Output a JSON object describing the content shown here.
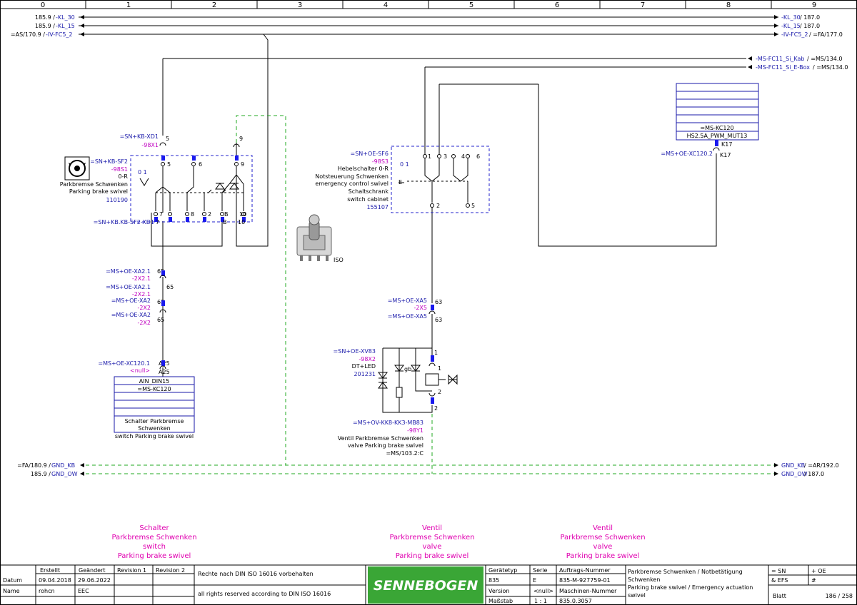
{
  "column_numbers": [
    "0",
    "1",
    "2",
    "3",
    "4",
    "5",
    "6",
    "7",
    "8",
    "9"
  ],
  "potentials": {
    "kl30": {
      "left_ref": "185.9 / ",
      "left_name": "-KL_30",
      "right_name": "-KL_30",
      "right_ref": " / 187.0"
    },
    "kl15": {
      "left_ref": "185.9 / ",
      "left_name": "-KL_15",
      "right_name": "-KL_15",
      "right_ref": " / 187.0"
    },
    "ivfc": {
      "left_ref": "=AS/170.9 / ",
      "left_name": "-IV-FC5_2",
      "right_name": "-IV-FC5_2",
      "right_ref": " / =FA/177.0"
    },
    "kab": {
      "name": "-MS-FC11_Si_Kab",
      "ref": " / =MS/134.0"
    },
    "ebox": {
      "name": "-MS-FC11_Si_E-Box",
      "ref": " / =MS/134.0"
    },
    "gndkb": {
      "left_ref": "=FA/180.9 / ",
      "left_name": "GND_KB",
      "right_name": "GND_KB",
      "right_ref": " / =AR/192.0"
    },
    "gndow": {
      "left_ref": "185.9 / ",
      "left_name": "GND_OW",
      "right_name": "GND_OW",
      "right_ref": " / 187.0"
    }
  },
  "switch_98s1": {
    "xd1_loc": "=SN+KB-XD1",
    "xd1_tag": "-98X1",
    "xd1_pin": "5",
    "top_pin9": "9",
    "loc": "=SN+KB-SF2",
    "tag": "-98S1",
    "pos": "0-R",
    "desc1": "Parkbremse  Schwenken",
    "desc2": "Parking brake  swivel",
    "part": "110190",
    "dial": "0 1",
    "contacts_top": [
      "5",
      "6",
      "9"
    ],
    "contacts_bottom": [
      "7",
      "8",
      "2",
      "B",
      "10"
    ],
    "bottom_loc": "=SN+KB.KB-SF2-XD1",
    "bottom_pins": [
      "7",
      "B",
      "10"
    ]
  },
  "connectors_left": [
    {
      "loc": "=MS+OE-XA2.1",
      "tag": "-2X2.1",
      "pin": "65"
    },
    {
      "loc": "=MS+OE-XA2.1",
      "tag": "-2X2.1",
      "pin": "65"
    },
    {
      "loc": "=MS+OE-XA2",
      "tag": "-2X2",
      "pin": "65"
    },
    {
      "loc": "=MS+OE-XA2",
      "tag": "-2X2",
      "pin": "65"
    }
  ],
  "xc120_1": {
    "loc": "=MS+OE-XC120.1",
    "tag": "<null>",
    "pin1": "A25",
    "pin2": "A25"
  },
  "ain_box": {
    "title": "AIN_DIN15",
    "sub": "=MS-KC120",
    "desc1": "Schalter Parkbremse",
    "desc2": "Schwenken",
    "desc3": "switch Parking brake swivel"
  },
  "image_label": "ISO",
  "switch_98s3": {
    "loc": "=SN+OE-SF6",
    "tag": "-98S3",
    "pos": "Hebelschalter 0-R",
    "desc1": "Notsteuerung Schwenken",
    "desc2": "emergency control swivel",
    "desc3": "Schaltschrank",
    "desc4": "switch cabinet",
    "part": "155107",
    "dial": "0 1",
    "contacts_top": [
      "1",
      "3",
      "4",
      "6"
    ],
    "contacts_bottom": [
      "2",
      "5"
    ]
  },
  "conn_right": [
    {
      "loc": "=MS+OE-XA5",
      "tag": "-2X5",
      "pin": "63"
    },
    {
      "loc": "=MS+OE-XA5",
      "tag": "",
      "pin": "63"
    }
  ],
  "valve": {
    "xv_loc": "=SN+OE-XV83",
    "xv_tag": "-98X2",
    "type": "DT+LED",
    "part": "201231",
    "gb": "gb",
    "pins": [
      "1",
      "1",
      "2",
      "2"
    ],
    "loc": "=MS+OV-KK8-KK3-MB83",
    "tag": "-98Y1",
    "desc1": "Ventil Parkbremse Schwenken",
    "desc2": "valve Parking brake swivel",
    "ref": "=MS/103.2:C"
  },
  "kc120": {
    "title": "=MS-KC120",
    "sub": "HS2.5A_PWM_MUT13",
    "pin": "K17",
    "loc": "=MS+OE-XC120.2",
    "pin2": "K17"
  },
  "bottom_labels": [
    {
      "l1": "Schalter",
      "l2": "Parkbremse Schwenken",
      "l3": "switch",
      "l4": "Parking brake swivel"
    },
    {
      "l1": "Ventil",
      "l2": "Parkbremse Schwenken",
      "l3": "valve",
      "l4": "Parking brake swivel"
    },
    {
      "l1": "Ventil",
      "l2": "Parkbremse Schwenken",
      "l3": "valve",
      "l4": "Parking brake swivel"
    }
  ],
  "title_block": {
    "erstellt": "Erstellt",
    "geaendert": "Geändert",
    "rev1": "Revision 1",
    "rev2": "Revision 2",
    "datum": "Datum",
    "date_created": "09.04.2018",
    "date_changed": "29.06.2022",
    "name": "Name",
    "name_created": "rohcn",
    "name_changed": "EEC",
    "rights_de": "Rechte nach DIN ISO 16016 vorbehalten",
    "rights_en": "all rights reserved according to DIN ISO 16016",
    "logo": "SENNEBOGEN",
    "geraetetyp_lbl": "Gerätetyp",
    "geraetetyp": "835",
    "serie_lbl": "Serie",
    "serie": "E",
    "auftrag_lbl": "Auftrags-Nummer",
    "auftrag": "835-M-927759-01",
    "version_lbl": "Version",
    "version": "<null>",
    "maschinen_lbl": "Maschinen-Nummer",
    "massstab_lbl": "Maßstab",
    "massstab": "1 : 1",
    "maschinen": "835.0.3057",
    "title1": "Parkbremse Schwenken / Notbetätigung",
    "title2": "Schwenken",
    "title3": "Parking brake swivel / Emergency actuation",
    "title4": "swivel",
    "sn": "= SN",
    "oe": "+ OE",
    "efs": "& EFS",
    "hash": "#",
    "blatt": "Blatt",
    "sheet": "186 / 258"
  }
}
